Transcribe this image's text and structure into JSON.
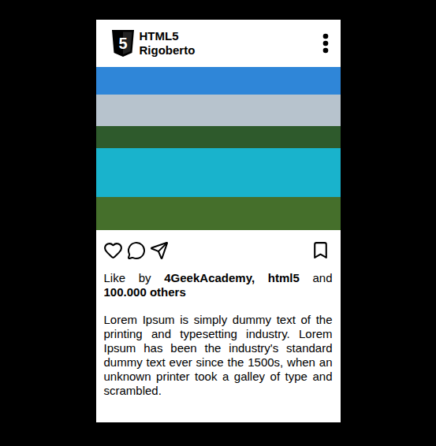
{
  "post": {
    "logo_text": "5",
    "title": "HTML5",
    "author": "Rigoberto",
    "likes": [
      {
        "text": "Like by ",
        "kind": "plain"
      },
      {
        "text": "4GeekAcademy, html5",
        "kind": "strong"
      },
      {
        "text": " and ",
        "kind": "plain"
      },
      {
        "text": "100.000 others",
        "kind": "strong"
      }
    ],
    "caption": "Lorem Ipsum is simply dummy text of the printing and typesetting industry. Lorem Ipsum has been the industry's standard dummy text ever since the 1500s, when an unknown printer took a galley of type and scrambled."
  }
}
